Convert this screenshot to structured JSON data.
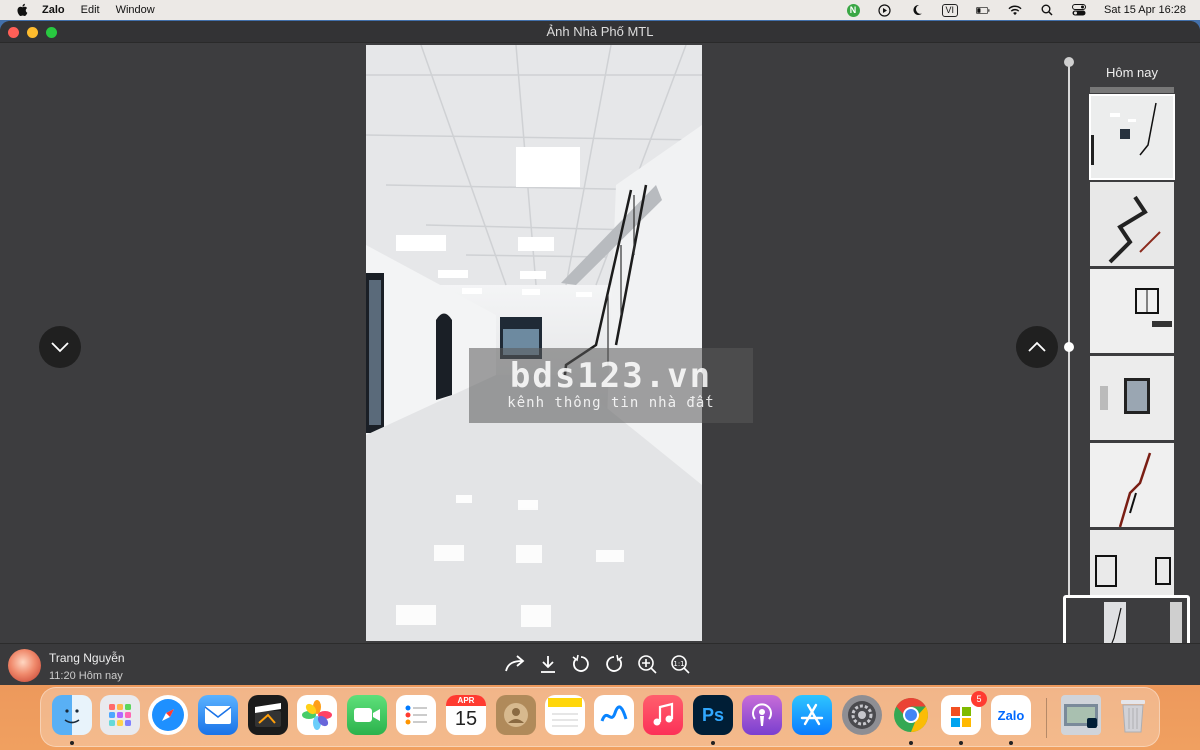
{
  "menubar": {
    "app_name": "Zalo",
    "menus": [
      "Edit",
      "Window"
    ],
    "input_source": "VI",
    "datetime": "Sat 15 Apr  16:28"
  },
  "window": {
    "title": "Ảnh Nhà Phố MTL"
  },
  "photo": {
    "watermark_main": "bds123.vn",
    "watermark_sub": "kênh thông tin nhà đất"
  },
  "timeline": {
    "date_label": "Hôm nay"
  },
  "footer": {
    "sender_name": "Trang Nguyễn",
    "sender_time": "11:20 Hôm nay"
  },
  "dock": {
    "calendar_month": "APR",
    "calendar_day": "15",
    "zalo_label": "Zalo",
    "ps_label": "Ps",
    "zalo_badge": "5"
  },
  "colors": {
    "window_bg": "#3d3d3f",
    "accent": "#ffffff"
  }
}
